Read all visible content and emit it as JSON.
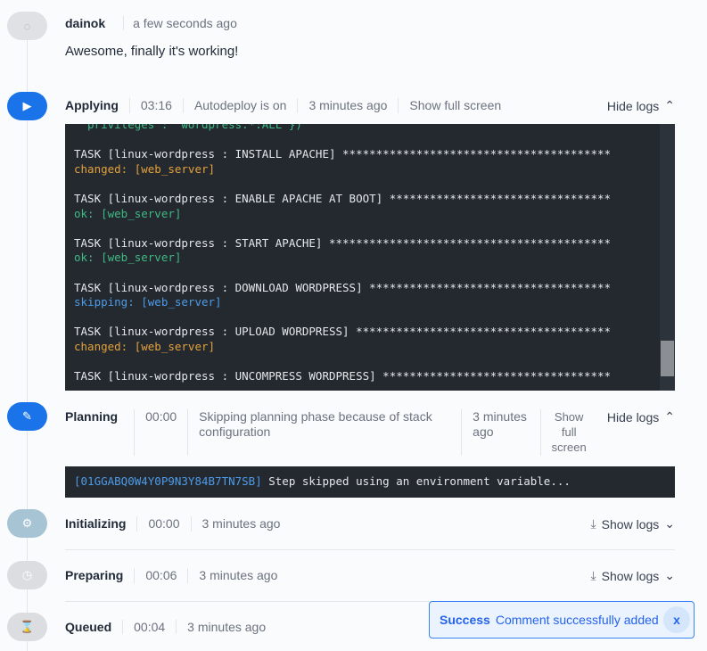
{
  "comment": {
    "author": "dainok",
    "time": "a few seconds ago",
    "text": "Awesome, finally it's working!"
  },
  "applying": {
    "title": "Applying",
    "duration": "03:16",
    "autodeploy": "Autodeploy is on",
    "time": "3 minutes ago",
    "fullscreen": "Show full screen",
    "toggle": "Hide logs",
    "log": [
      {
        "t": "  privileges : 'wordpress.*:ALL'})",
        "c": "g"
      },
      {
        "t": "",
        "c": ""
      },
      {
        "t": "TASK [linux-wordpress : INSTALL APACHE] ****************************************",
        "c": ""
      },
      {
        "t": "changed: [web_server]",
        "c": "o"
      },
      {
        "t": "",
        "c": ""
      },
      {
        "t": "TASK [linux-wordpress : ENABLE APACHE AT BOOT] *********************************",
        "c": ""
      },
      {
        "t": "ok: [web_server]",
        "c": "g"
      },
      {
        "t": "",
        "c": ""
      },
      {
        "t": "TASK [linux-wordpress : START APACHE] ******************************************",
        "c": ""
      },
      {
        "t": "ok: [web_server]",
        "c": "g"
      },
      {
        "t": "",
        "c": ""
      },
      {
        "t": "TASK [linux-wordpress : DOWNLOAD WORDPRESS] ************************************",
        "c": ""
      },
      {
        "t": "skipping: [web_server]",
        "c": "b"
      },
      {
        "t": "",
        "c": ""
      },
      {
        "t": "TASK [linux-wordpress : UPLOAD WORDPRESS] **************************************",
        "c": ""
      },
      {
        "t": "changed: [web_server]",
        "c": "o"
      },
      {
        "t": "",
        "c": ""
      },
      {
        "t": "TASK [linux-wordpress : UNCOMPRESS WORDPRESS] **********************************",
        "c": ""
      }
    ]
  },
  "planning": {
    "title": "Planning",
    "duration": "00:00",
    "message": "Skipping planning phase because of stack configuration",
    "time": "3 minutes ago",
    "fullscreen": "Show full screen",
    "toggle": "Hide logs",
    "log_id": "[01GGABQ0W4Y0P9N3Y84B7TN7SB]",
    "log_text": " Step skipped using an environment variable..."
  },
  "initializing": {
    "title": "Initializing",
    "duration": "00:00",
    "time": "3 minutes ago",
    "toggle": "Show logs"
  },
  "preparing": {
    "title": "Preparing",
    "duration": "00:06",
    "time": "3 minutes ago",
    "toggle": "Show logs"
  },
  "queued": {
    "title": "Queued",
    "duration": "00:04",
    "time": "3 minutes ago"
  },
  "toast": {
    "label": "Success",
    "message": "Comment successfully added",
    "close": "x"
  }
}
